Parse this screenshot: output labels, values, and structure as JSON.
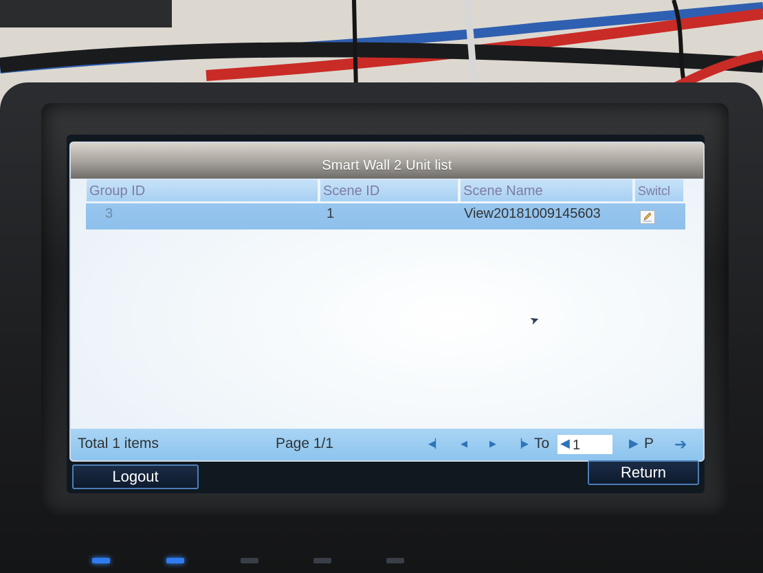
{
  "window": {
    "title": "Smart Wall 2 Unit list"
  },
  "table": {
    "columns": [
      "Group ID",
      "Scene ID",
      "Scene Name",
      "Switcl"
    ],
    "rows": [
      {
        "group_id": "3",
        "scene_id": "1",
        "scene_name": "View20181009145603",
        "action_icon": "edit-icon"
      }
    ]
  },
  "footer": {
    "total": "Total 1 items",
    "page": "Page 1/1",
    "goto_label": "To",
    "goto_value": "1",
    "page_suffix": "P",
    "nav_icons": [
      "first-page-icon",
      "prev-page-icon",
      "next-page-icon",
      "last-page-icon",
      "go-icon"
    ]
  },
  "buttons": {
    "logout": "Logout",
    "return": "Return"
  },
  "colors": {
    "header_blue": "#a8d0f2",
    "row_blue": "#8ec0ec",
    "footer_blue": "#8cc4ee",
    "button_border": "#4d7fb7",
    "title_gray": "#a9a59f"
  }
}
